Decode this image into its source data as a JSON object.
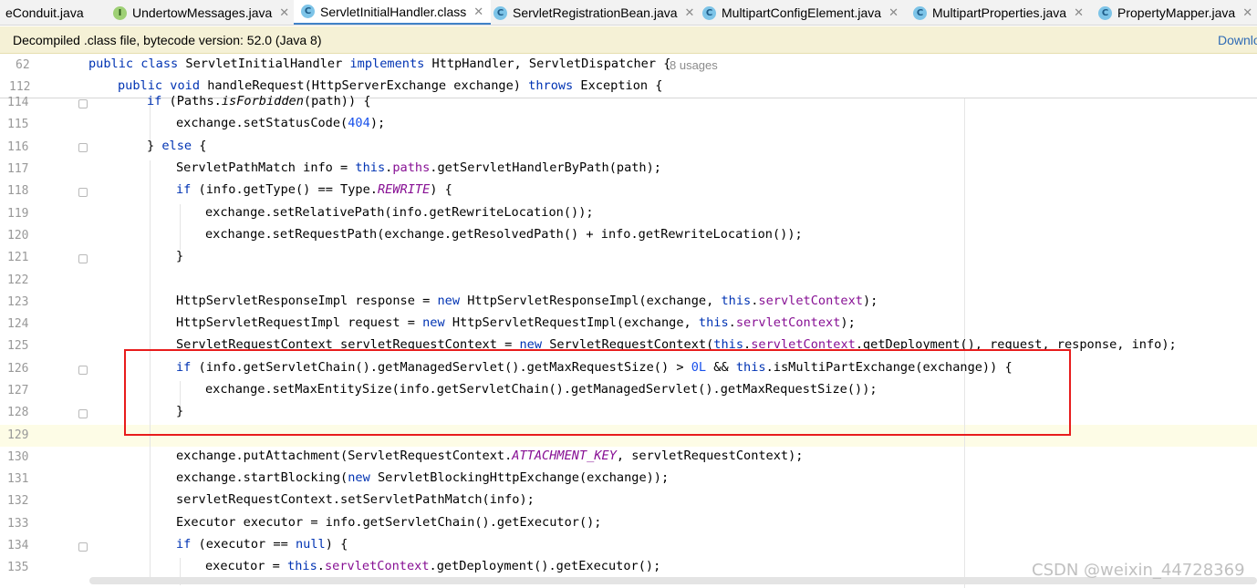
{
  "tabs": [
    {
      "label": "eConduit.java",
      "icon": "none",
      "active": false
    },
    {
      "label": "UndertowMessages.java",
      "icon": "interface-icon",
      "active": false
    },
    {
      "label": "ServletInitialHandler.class",
      "icon": "class-icon",
      "active": true
    },
    {
      "label": "ServletRegistrationBean.java",
      "icon": "class-icon",
      "active": false
    },
    {
      "label": "MultipartConfigElement.java",
      "icon": "class-icon",
      "active": false
    },
    {
      "label": "MultipartProperties.java",
      "icon": "class-icon",
      "active": false
    },
    {
      "label": "PropertyMapper.java",
      "icon": "class-locked-icon",
      "active": false
    }
  ],
  "notice": {
    "message": "Decompiled .class file, bytecode version: 52.0 (Java 8)",
    "link": "Downlo"
  },
  "sticky": {
    "line1_num": "62",
    "line1_code": "public class ServletInitialHandler implements HttpHandler, ServletDispatcher {",
    "line1_usages": "8 usages",
    "line2_num": "112",
    "line2_code": "public void handleRequest(HttpServerExchange exchange) throws Exception {"
  },
  "code_lines": [
    {
      "num": "114",
      "text": "if (Paths.isForbidden(path)) {"
    },
    {
      "num": "115",
      "text": "exchange.setStatusCode(404);"
    },
    {
      "num": "116",
      "text": "} else {"
    },
    {
      "num": "117",
      "text": "ServletPathMatch info = this.paths.getServletHandlerByPath(path);"
    },
    {
      "num": "118",
      "text": "if (info.getType() == Type.REWRITE) {"
    },
    {
      "num": "119",
      "text": "exchange.setRelativePath(info.getRewriteLocation());"
    },
    {
      "num": "120",
      "text": "exchange.setRequestPath(exchange.getResolvedPath() + info.getRewriteLocation());"
    },
    {
      "num": "121",
      "text": "}"
    },
    {
      "num": "122",
      "text": ""
    },
    {
      "num": "123",
      "text": "HttpServletResponseImpl response = new HttpServletResponseImpl(exchange, this.servletContext);"
    },
    {
      "num": "124",
      "text": "HttpServletRequestImpl request = new HttpServletRequestImpl(exchange, this.servletContext);"
    },
    {
      "num": "125",
      "text": "ServletRequestContext servletRequestContext = new ServletRequestContext(this.servletContext.getDeployment(), request, response, info);"
    },
    {
      "num": "126",
      "text": "if (info.getServletChain().getManagedServlet().getMaxRequestSize() > 0L && this.isMultiPartExchange(exchange)) {"
    },
    {
      "num": "127",
      "text": "exchange.setMaxEntitySize(info.getServletChain().getManagedServlet().getMaxRequestSize());"
    },
    {
      "num": "128",
      "text": "}"
    },
    {
      "num": "129",
      "text": ""
    },
    {
      "num": "130",
      "text": "exchange.putAttachment(ServletRequestContext.ATTACHMENT_KEY, servletRequestContext);"
    },
    {
      "num": "131",
      "text": "exchange.startBlocking(new ServletBlockingHttpExchange(exchange));"
    },
    {
      "num": "132",
      "text": "servletRequestContext.setServletPathMatch(info);"
    },
    {
      "num": "133",
      "text": "Executor executor = info.getServletChain().getExecutor();"
    },
    {
      "num": "134",
      "text": "if (executor == null) {"
    },
    {
      "num": "135",
      "text": "executor = this.servletContext.getDeployment().getExecutor();"
    }
  ],
  "watermark": "CSDN @weixin_44728369",
  "colors": {
    "keyword": "#0033b3",
    "number": "#1750eb",
    "field": "#871094",
    "highlight_box": "#e81c1c",
    "notice_bg": "#f5f1d6",
    "active_tab_underline": "#4083c9"
  }
}
